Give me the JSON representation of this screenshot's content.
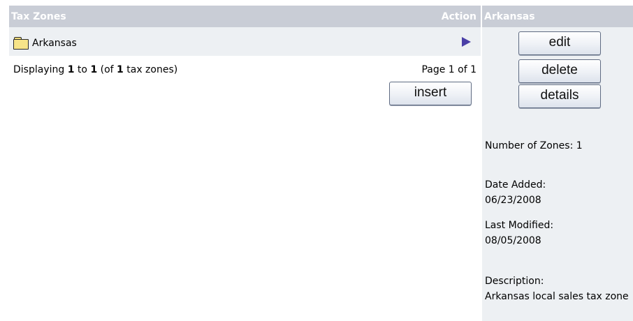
{
  "list": {
    "header_title": "Tax Zones",
    "header_action": "Action",
    "rows": [
      {
        "name": "Arkansas",
        "icon": "folder-icon",
        "action_icon": "select-arrow-icon"
      }
    ],
    "display_prefix": "Displaying ",
    "display_from": "1",
    "display_to_word": " to ",
    "display_to": "1",
    "display_of_open": " (of ",
    "display_total": "1",
    "display_suffix": " tax zones)",
    "page_info": "Page 1 of 1",
    "insert_label": "insert"
  },
  "panel": {
    "title": "Arkansas",
    "edit_label": "edit",
    "delete_label": "delete",
    "details_label": "details",
    "number_of_zones": "Number of Zones: 1",
    "date_added_label": "Date Added:",
    "date_added": "06/23/2008",
    "last_modified_label": "Last Modified:",
    "last_modified": "08/05/2008",
    "description_label": "Description:",
    "description": "Arkansas local sales tax zone"
  },
  "colors": {
    "header_bg": "#c9cdd6",
    "row_bg": "#edf0f3",
    "arrow": "#4a3fa6"
  }
}
